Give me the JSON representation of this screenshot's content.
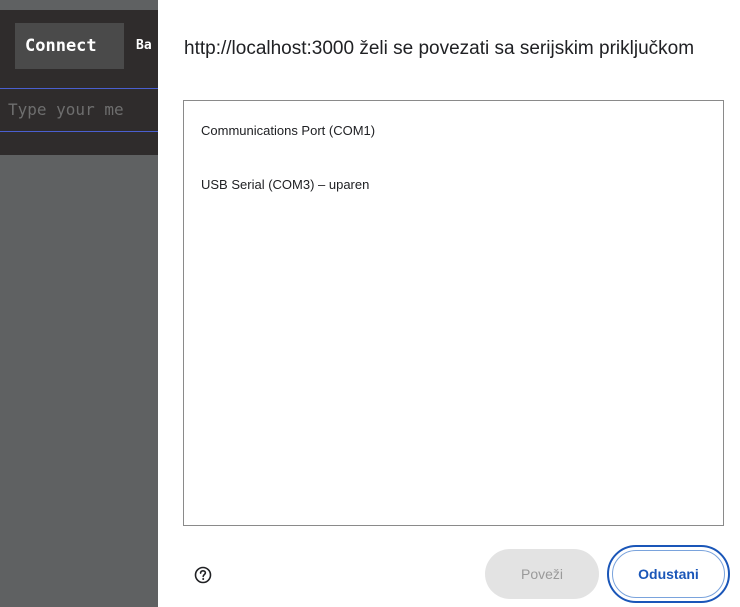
{
  "app": {
    "connect_label": "Connect",
    "second_label": "Ba",
    "message_placeholder": "Type your me"
  },
  "dialog": {
    "title": "http://localhost:3000 želi se povezati sa serijskim priključkom",
    "ports": [
      {
        "label": "Communications Port (COM1)"
      },
      {
        "label": "USB Serial (COM3) – uparen"
      }
    ],
    "help_icon": "help-circle-icon",
    "connect_button": "Poveži",
    "cancel_button": "Odustani"
  },
  "colors": {
    "app_background": "#2f2c2c",
    "overlay": "#5f6162",
    "input_border": "#4a5fd0",
    "primary": "#1a56b8",
    "disabled_button": "#e3e3e3"
  }
}
